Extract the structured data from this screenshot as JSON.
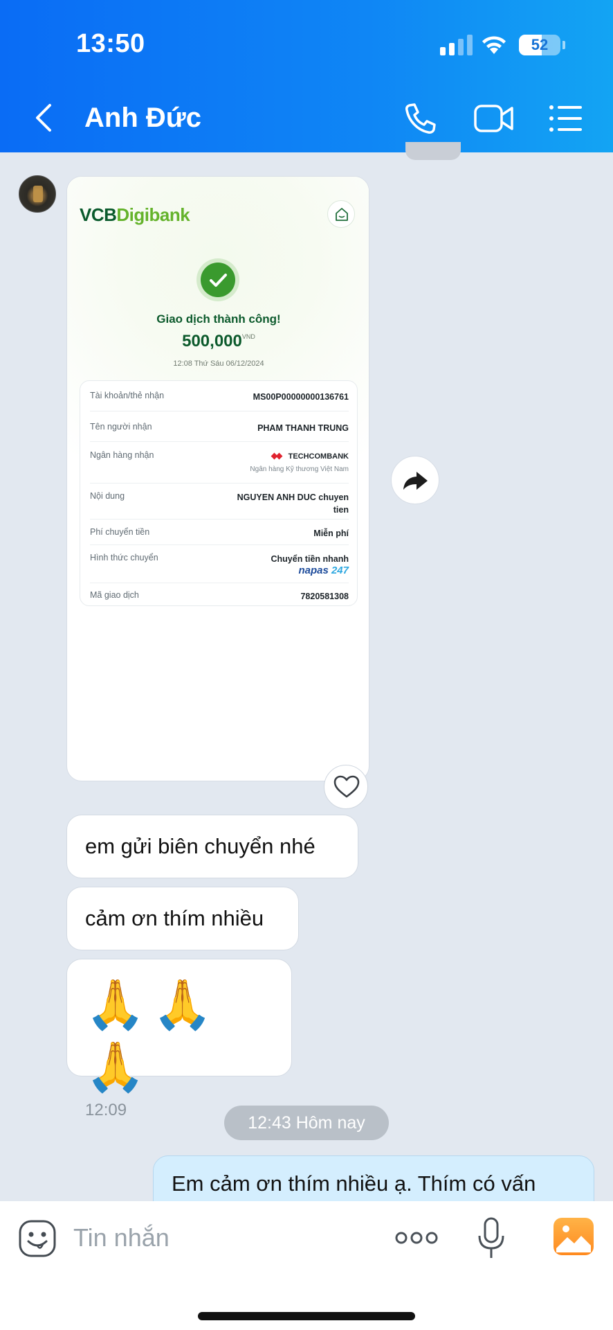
{
  "status_bar": {
    "time": "13:50",
    "battery": "52"
  },
  "header": {
    "contact_name": "Anh Đức"
  },
  "receipt": {
    "logo_vcb": "VCB",
    "logo_digibank": "Digibank",
    "success_title": "Giao dịch thành công!",
    "amount": "500,000",
    "currency": "VND",
    "datetime": "12:08 Thứ Sáu 06/12/2024",
    "rows": [
      {
        "label": "Tài khoản/thẻ nhận",
        "value": "MS00P00000000136761"
      },
      {
        "label": "Tên người nhận",
        "value": "PHAM THANH TRUNG"
      },
      {
        "label": "Ngân hàng nhận",
        "value": "TECHCOMBANK",
        "sub": "Ngân hàng Kỹ thương Việt Nam"
      },
      {
        "label": "Nội dung",
        "value": "NGUYEN ANH DUC chuyen",
        "value2": "tien"
      },
      {
        "label": "Phí chuyển tiền",
        "value": "Miễn phí"
      },
      {
        "label": "Hình thức chuyển",
        "value": "Chuyển tiền nhanh",
        "napas1": "napas",
        "napas2": "247"
      },
      {
        "label": "Mã giao dịch",
        "value": "7820581308"
      }
    ]
  },
  "messages": {
    "m1": "em gửi biên chuyển nhé",
    "m2": "cảm ơn thím nhiều",
    "m3_emoji": "🙏🙏🙏",
    "m3_time": "12:09",
    "date_pill": "12:43 Hôm nay",
    "my_message": "Em cảm ơn thím nhiều ạ. Thím có vấn"
  },
  "composer": {
    "placeholder": "Tin nhắn"
  }
}
